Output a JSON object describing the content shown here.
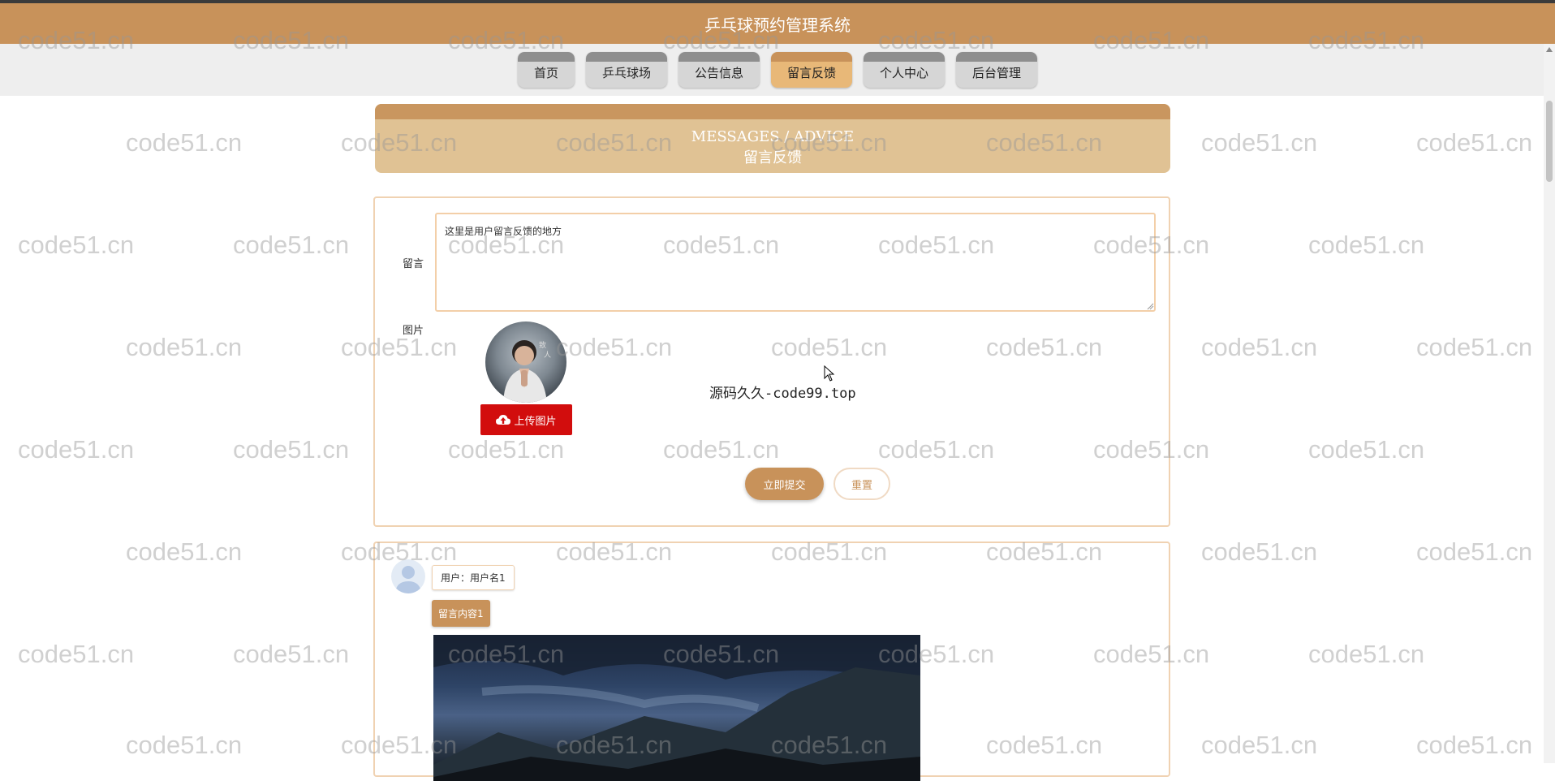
{
  "header": {
    "title": "乒乓球预约管理系统"
  },
  "nav": {
    "items": [
      {
        "label": "首页"
      },
      {
        "label": "乒乓球场"
      },
      {
        "label": "公告信息"
      },
      {
        "label": "留言反馈"
      },
      {
        "label": "个人中心"
      },
      {
        "label": "后台管理"
      }
    ],
    "active": "留言反馈"
  },
  "banner": {
    "title_en": "MESSAGES / ADVICE",
    "title_cn": "留言反馈"
  },
  "form": {
    "message_label": "留言",
    "message_value": "这里是用户留言反馈的地方",
    "image_label": "图片",
    "upload_label": "上传图片",
    "overlay_text": "源码久久-code99.top",
    "submit_label": "立即提交",
    "reset_label": "重置"
  },
  "messages": [
    {
      "user": "用户：用户名1",
      "content": "留言内容1"
    }
  ],
  "watermark": {
    "text": "code51.cn"
  },
  "colors": {
    "brand": "#c8925a",
    "banner": "#e0c294",
    "upload": "#d20d0d"
  },
  "icons": {
    "upload": "cloud-upload-icon",
    "avatar": "user-avatar-icon",
    "cursor": "mouse-pointer-icon"
  }
}
